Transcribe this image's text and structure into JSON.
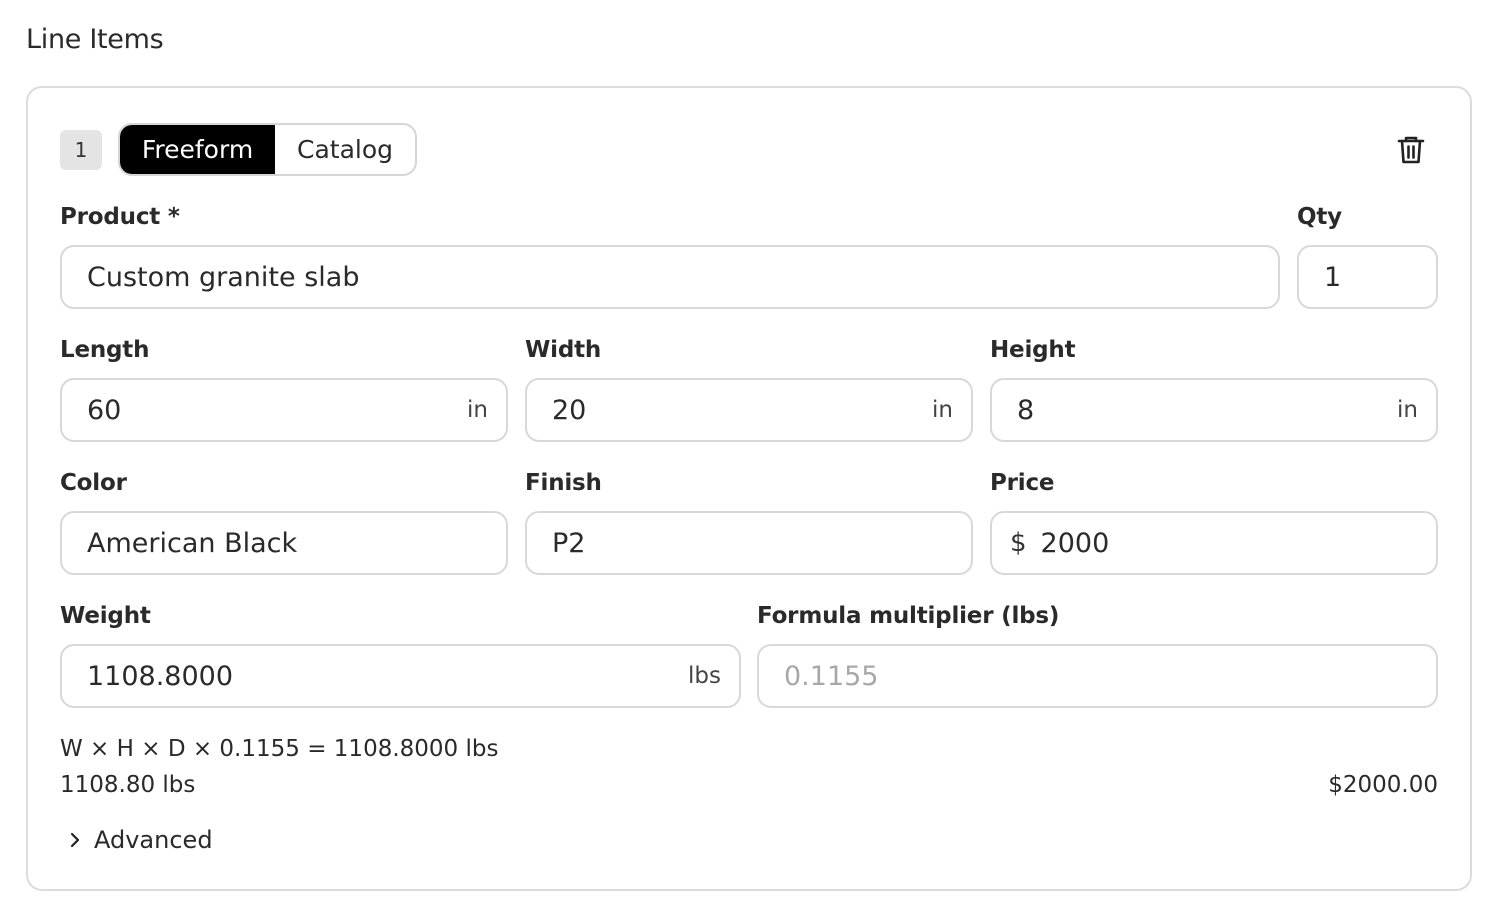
{
  "section": {
    "title": "Line Items"
  },
  "item": {
    "index": "1",
    "modes": {
      "freeform": "Freeform",
      "catalog": "Catalog"
    },
    "product": {
      "label": "Product *",
      "value": "Custom granite slab"
    },
    "qty": {
      "label": "Qty",
      "value": "1"
    },
    "length": {
      "label": "Length",
      "value": "60",
      "unit": "in"
    },
    "width": {
      "label": "Width",
      "value": "20",
      "unit": "in"
    },
    "height": {
      "label": "Height",
      "value": "8",
      "unit": "in"
    },
    "color": {
      "label": "Color",
      "value": "American Black"
    },
    "finish": {
      "label": "Finish",
      "value": "P2"
    },
    "price": {
      "label": "Price",
      "prefix": "$",
      "value": "2000"
    },
    "weight": {
      "label": "Weight",
      "value": "1108.8000",
      "unit": "lbs"
    },
    "formula_multiplier": {
      "label": "Formula multiplier (lbs)",
      "placeholder": "0.1155"
    },
    "formula_text": "W × H × D × 0.1155 = 1108.8000 lbs",
    "weight_summary": "1108.80 lbs",
    "price_summary": "$2000.00",
    "advanced_label": "Advanced"
  },
  "icons": {
    "delete": "trash-icon",
    "expand": "chevron-right-icon"
  }
}
